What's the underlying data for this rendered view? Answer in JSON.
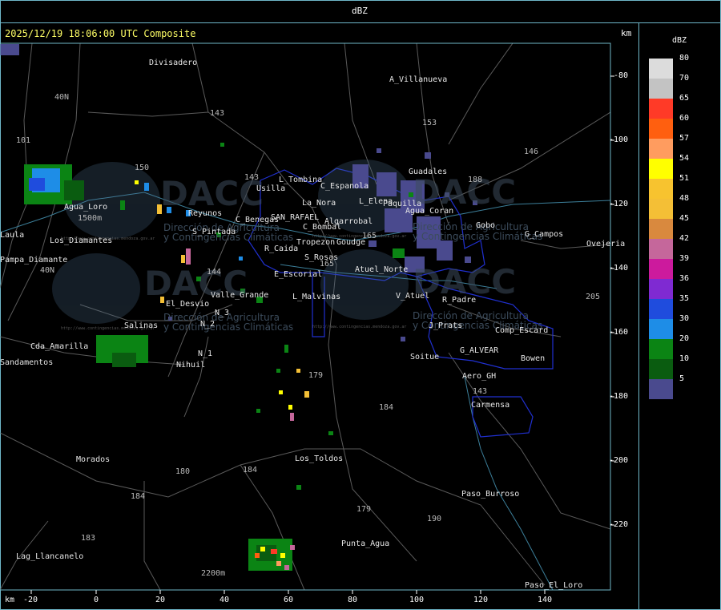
{
  "header": {
    "title": "dBZ"
  },
  "map": {
    "timestamp": "2025/12/19 18:06:00 UTC Composite",
    "unit_label": "km",
    "watermark_text": "DACC",
    "watermark_subtitle_1": "Dirección de Agricultura",
    "watermark_subtitle_2": "y Contingencias Climáticas",
    "watermark_url": "http://www.contingencias.mendoza.gov.ar"
  },
  "x_ticks": [
    "km",
    "-20",
    "0",
    "20",
    "40",
    "60",
    "80",
    "100",
    "120",
    "140"
  ],
  "y_ticks": [
    "-80",
    "-100",
    "-120",
    "-140",
    "-160",
    "-180",
    "-200",
    "-220"
  ],
  "places": [
    "Divisadero",
    "A_Villanueva",
    "Guadales",
    "L_Tombina",
    "C_Espanola",
    "Usilla",
    "La_Nora",
    "L_Elena",
    "Paquilla",
    "Agua_Coran",
    "Gobo",
    "G_Campos",
    "Ovejeria",
    "Agua_Loro",
    "Reyunos",
    "Los_Diamantes",
    "Pampa_Diamante",
    "S_Pintada",
    "C_Benegas",
    "SAN_RAFAEL",
    "Algarrobal",
    "C_Bombal",
    "Tropezon",
    "Goudge",
    "R_Caida",
    "S_Rosas",
    "Atuel_Norte",
    "E_Escorial",
    "Valle_Grande",
    "L_Malvinas",
    "V_Atuel",
    "R_Padre",
    "El_Desvio",
    "Salinas",
    "Cda_Amarilla",
    "Comp_Escard",
    "J_Prats",
    "G_ALVEAR",
    "Bowen",
    "N_2",
    "N_3",
    "N_1",
    "Nihuil",
    "Soitue",
    "Aero_GH",
    "Carmensa",
    "Morados",
    "Los_Toldos",
    "Paso_Burroso",
    "Punta_Agua",
    "Lag_Llancanelo",
    "Paso_El_Loro",
    "Sandamentos",
    "Laula"
  ],
  "routes": [
    "40N",
    "101",
    "143",
    "153",
    "146",
    "188",
    "150",
    "143",
    "144",
    "165",
    "165",
    "179",
    "184",
    "180",
    "184",
    "184",
    "183",
    "179",
    "190",
    "143",
    "205",
    "2200m",
    "1500m",
    "40N"
  ],
  "legend": {
    "title": "dBZ",
    "items": [
      {
        "value": "80",
        "color": "#dcdcdc"
      },
      {
        "value": "70",
        "color": "#c3c3c3"
      },
      {
        "value": "65",
        "color": "#ff3a27"
      },
      {
        "value": "60",
        "color": "#ff5f0f"
      },
      {
        "value": "57",
        "color": "#ff9c5f"
      },
      {
        "value": "54",
        "color": "#ffff00"
      },
      {
        "value": "51",
        "color": "#f7c32f"
      },
      {
        "value": "48",
        "color": "#f4bf36"
      },
      {
        "value": "45",
        "color": "#d9893e"
      },
      {
        "value": "42",
        "color": "#c5679b"
      },
      {
        "value": "39",
        "color": "#cc1a9d"
      },
      {
        "value": "36",
        "color": "#7f2ad2"
      },
      {
        "value": "35",
        "color": "#1f4cdd"
      },
      {
        "value": "30",
        "color": "#1e8de7"
      },
      {
        "value": "20",
        "color": "#0b8414"
      },
      {
        "value": "10",
        "color": "#0a5c10"
      },
      {
        "value": "5",
        "color": "#4a4a8e"
      }
    ]
  }
}
